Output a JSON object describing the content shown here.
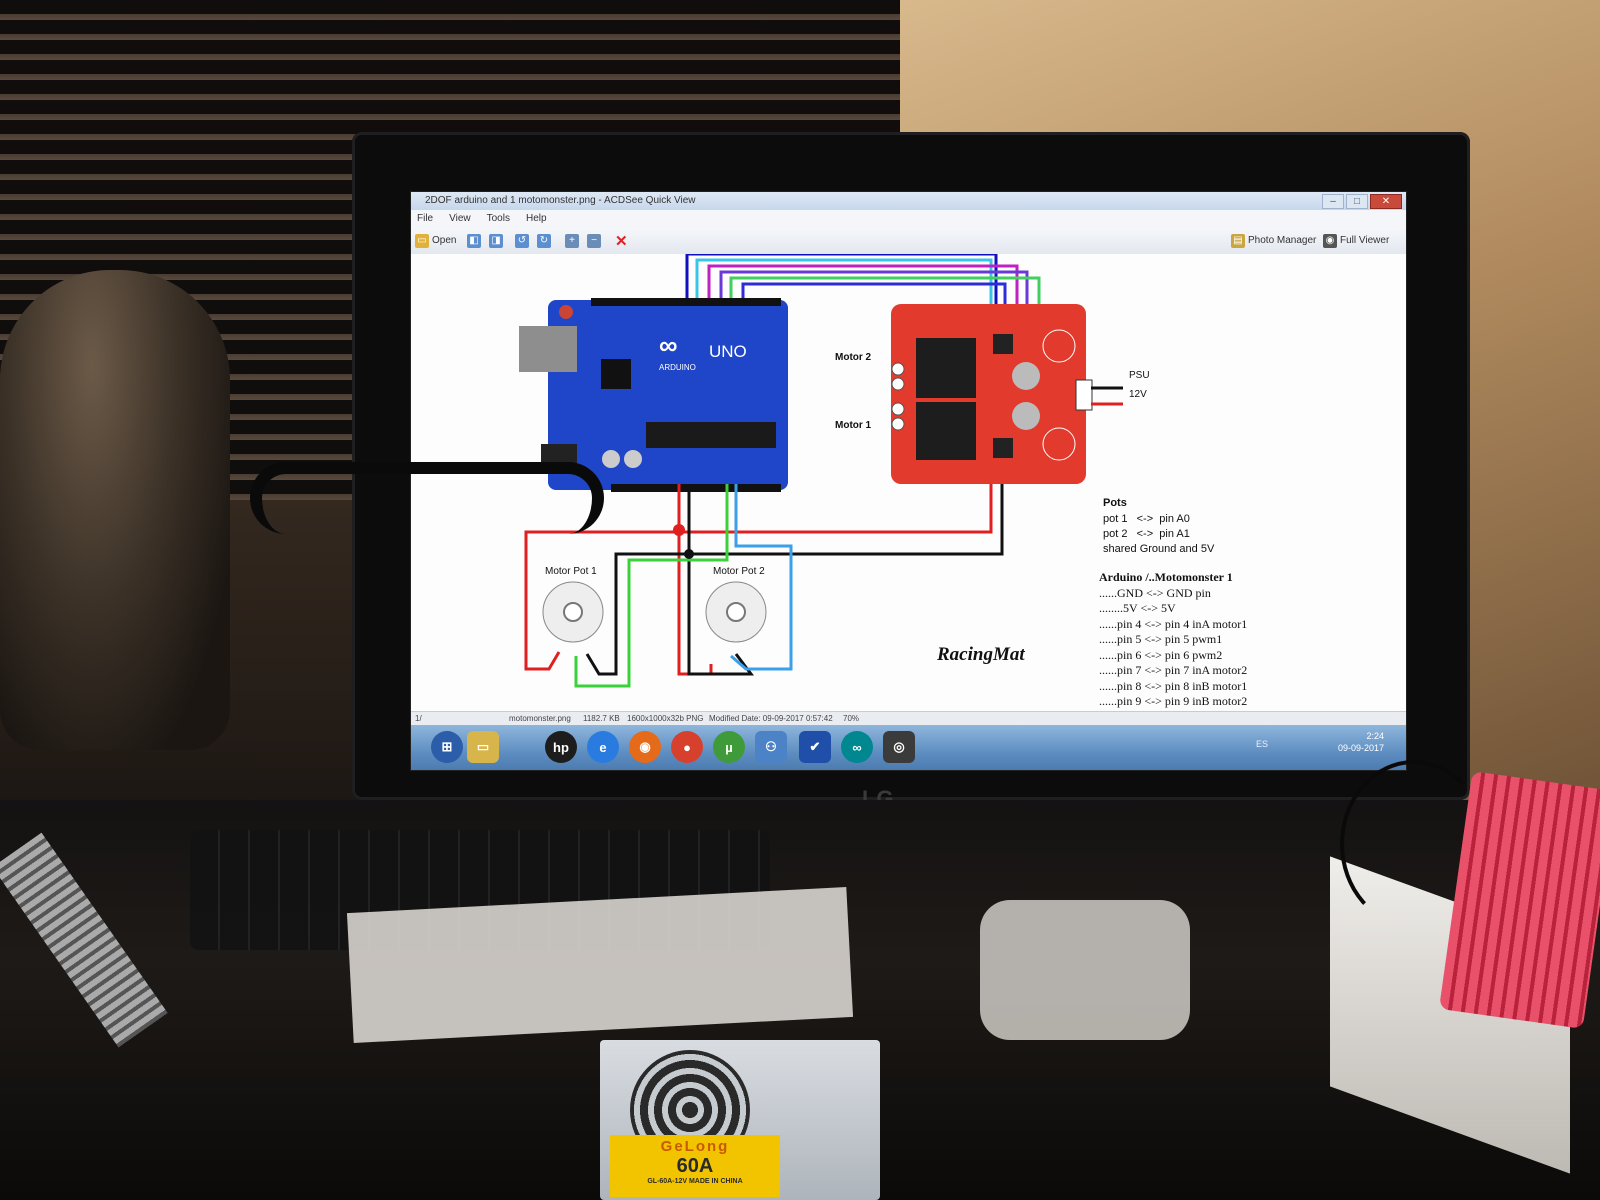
{
  "window": {
    "title": "2DOF arduino and 1 motomonster.png - ACDSee Quick View",
    "menu": [
      "File",
      "View",
      "Tools",
      "Help"
    ],
    "toolbar": {
      "open": "Open",
      "photo_manager": "Photo Manager",
      "full_viewer": "Full Viewer"
    }
  },
  "diagram": {
    "board1": {
      "name": "UNO",
      "sub": "ARDUINO"
    },
    "motor2": "Motor 2",
    "motor1": "Motor 1",
    "psu": "PSU",
    "psu_v": "12V",
    "pot1": "Motor Pot 1",
    "pot2": "Motor Pot 2",
    "logo": "RacingMat",
    "pots_title": "Pots",
    "pots_lines": [
      "pot 1   <->  pin A0",
      "pot 2   <->  pin A1",
      "shared Ground and 5V"
    ],
    "map_title": "Arduino /..Motomonster 1",
    "map_lines": [
      "......GND <-> GND pin",
      "........5V <-> 5V",
      "......pin 4 <-> pin 4 inA motor1",
      "......pin 5 <-> pin 5 pwm1",
      "......pin 6 <-> pin 6 pwm2",
      "......pin 7 <-> pin 7 inA motor2",
      "......pin 8 <-> pin 8 inB motor1",
      "......pin 9 <-> pin 9 inB motor2"
    ]
  },
  "status": {
    "index": "1/",
    "file": "motomonster.png",
    "size": "1182.7 KB",
    "dims": "1600x1000x32b PNG",
    "modified": "Modified Date: 09-09-2017 0:57:42",
    "zoom": "70%"
  },
  "taskbar": {
    "lang": "ES",
    "time": "2:24",
    "date": "09-09-2017",
    "icons": [
      "hp-icon",
      "ie-icon",
      "firefox-icon",
      "chrome-icon",
      "utorrent-icon",
      "network-icon",
      "check-icon",
      "arduino-icon",
      "acdsee-icon"
    ]
  },
  "monitor": {
    "brand": "LG"
  },
  "psu_box": {
    "brand": "GeLong",
    "rating": "60A",
    "model": "GL-60A-12V  MADE IN CHINA"
  },
  "colors": {
    "arduino": "#1f45c9",
    "motomonster": "#e23a2c",
    "wire_red": "#e02020",
    "wire_black": "#111111",
    "wire_green": "#3ad13a",
    "wire_blue": "#3aa0e8"
  }
}
